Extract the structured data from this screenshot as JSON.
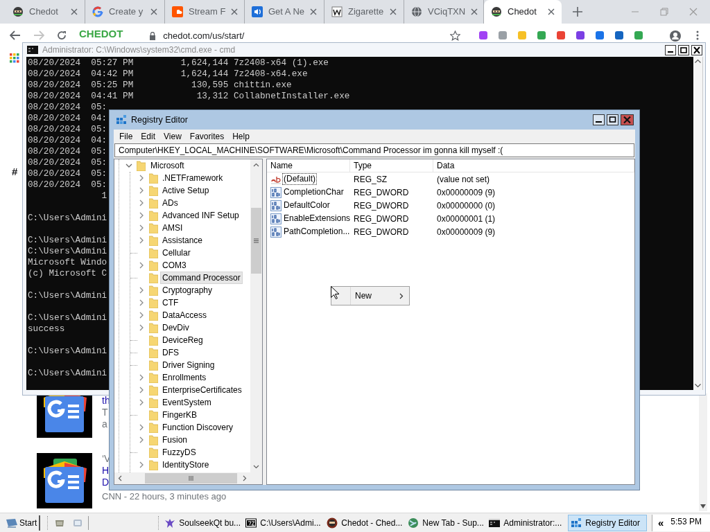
{
  "browser": {
    "tabs": [
      {
        "title": "Chedot",
        "selected": false
      },
      {
        "title": "Create y",
        "selected": false
      },
      {
        "title": "Stream F",
        "selected": false
      },
      {
        "title": "Get A Ne",
        "selected": false
      },
      {
        "title": "Zigarette",
        "selected": false
      },
      {
        "title": "VCiqTXN",
        "selected": false
      },
      {
        "title": "Chedot",
        "selected": true
      }
    ],
    "logo": "CHEDOT",
    "address": "chedot.com/us/start/",
    "page": {
      "hash": "#",
      "news": [
        {
          "lines": [
            {
              "kind": "link",
              "text": "th"
            },
            {
              "kind": "text",
              "text": "T"
            },
            {
              "kind": "text",
              "text": "a"
            }
          ]
        },
        {
          "lines": [
            {
              "kind": "quote",
              "text": "‘V"
            },
            {
              "kind": "link",
              "text": "H"
            },
            {
              "kind": "link",
              "text": "D"
            },
            {
              "kind": "meta",
              "text": "CNN - 22 hours, 3 minutes ago"
            }
          ]
        }
      ]
    }
  },
  "cmd": {
    "title": "Administrator: C:\\Windows\\system32\\cmd.exe - cmd",
    "blocks": [
      [
        "08/20/2024  05:27 PM         1,624,144 7z2408-x64 (1).exe",
        "08/20/2024  04:42 PM         1,624,144 7z2408-x64.exe",
        "08/20/2024  05:25 PM           130,595 chittin.exe",
        "08/20/2024  04:41 PM            13,312 CollabnetInstaller.exe",
        "08/20/2024  05:",
        "08/20/2024  04:",
        "08/20/2024  05:",
        "08/20/2024  04:",
        "08/20/2024  05:",
        "08/20/2024  05:",
        "08/20/2024  05:",
        "08/20/2024  05:",
        "              1"
      ],
      [
        "C:\\Users\\Admini"
      ],
      [
        "C:\\Users\\Admini",
        "C:\\Users\\Admini",
        "Microsoft Windo",
        "(c) Microsoft C"
      ],
      [
        "C:\\Users\\Admini"
      ],
      [
        "C:\\Users\\Admini",
        "success"
      ],
      [
        "C:\\Users\\Admini"
      ],
      [
        "C:\\Users\\Admini"
      ]
    ]
  },
  "registry": {
    "title": "Registry Editor",
    "menu": [
      "File",
      "Edit",
      "View",
      "Favorites",
      "Help"
    ],
    "address": "Computer\\HKEY_LOCAL_MACHINE\\SOFTWARE\\Microsoft\\Command Processor im gonna kill myself :(",
    "tree": {
      "label": "Microsoft",
      "expanded": true,
      "children": [
        {
          "label": ".NETFramework",
          "expandable": true,
          "selected": false
        },
        {
          "label": "Active Setup",
          "expandable": true,
          "selected": false
        },
        {
          "label": "ADs",
          "expandable": true,
          "selected": false
        },
        {
          "label": "Advanced INF Setup",
          "expandable": true,
          "selected": false
        },
        {
          "label": "AMSI",
          "expandable": true,
          "selected": false
        },
        {
          "label": "Assistance",
          "expandable": true,
          "selected": false
        },
        {
          "label": "Cellular",
          "expandable": false,
          "selected": false
        },
        {
          "label": "COM3",
          "expandable": true,
          "selected": false
        },
        {
          "label": "Command Processor",
          "expandable": false,
          "selected": true
        },
        {
          "label": "Cryptography",
          "expandable": true,
          "selected": false
        },
        {
          "label": "CTF",
          "expandable": true,
          "selected": false
        },
        {
          "label": "DataAccess",
          "expandable": true,
          "selected": false
        },
        {
          "label": "DevDiv",
          "expandable": true,
          "selected": false
        },
        {
          "label": "DeviceReg",
          "expandable": false,
          "selected": false
        },
        {
          "label": "DFS",
          "expandable": false,
          "selected": false
        },
        {
          "label": "Driver Signing",
          "expandable": false,
          "selected": false
        },
        {
          "label": "Enrollments",
          "expandable": true,
          "selected": false
        },
        {
          "label": "EnterpriseCertificates",
          "expandable": true,
          "selected": false
        },
        {
          "label": "EventSystem",
          "expandable": true,
          "selected": false
        },
        {
          "label": "FingerKB",
          "expandable": false,
          "selected": false
        },
        {
          "label": "Function Discovery",
          "expandable": true,
          "selected": false
        },
        {
          "label": "Fusion",
          "expandable": true,
          "selected": false
        },
        {
          "label": "FuzzyDS",
          "expandable": false,
          "selected": false
        },
        {
          "label": "IdentityStore",
          "expandable": true,
          "selected": false
        }
      ]
    },
    "columns": [
      "Name",
      "Type",
      "Data"
    ],
    "values": [
      {
        "kind": "string",
        "name": "(Default)",
        "type": "REG_SZ",
        "data": "(value not set)",
        "focused": true
      },
      {
        "kind": "dword",
        "name": "CompletionChar",
        "type": "REG_DWORD",
        "data": "0x00000009 (9)",
        "focused": false
      },
      {
        "kind": "dword",
        "name": "DefaultColor",
        "type": "REG_DWORD",
        "data": "0x00000000 (0)",
        "focused": false
      },
      {
        "kind": "dword",
        "name": "EnableExtensions",
        "type": "REG_DWORD",
        "data": "0x00000001 (1)",
        "focused": false
      },
      {
        "kind": "dword",
        "name": "PathCompletion...",
        "type": "REG_DWORD",
        "data": "0x00000009 (9)",
        "focused": false
      }
    ]
  },
  "context_menu": {
    "items": [
      {
        "label": "New",
        "submenu": true
      }
    ]
  },
  "taskbar": {
    "start": "Start",
    "tasks": [
      {
        "label": "SoulseekQt bu...",
        "selected": false
      },
      {
        "label": "C:\\Users\\Admi...",
        "selected": false
      },
      {
        "label": "Chedot - Ched...",
        "selected": false
      },
      {
        "label": "New Tab - Sup...",
        "selected": false
      },
      {
        "label": "Administrator:...",
        "selected": false
      },
      {
        "label": "Registry Editor",
        "selected": true
      }
    ],
    "overflow": "«",
    "clock": "5:53 PM"
  }
}
